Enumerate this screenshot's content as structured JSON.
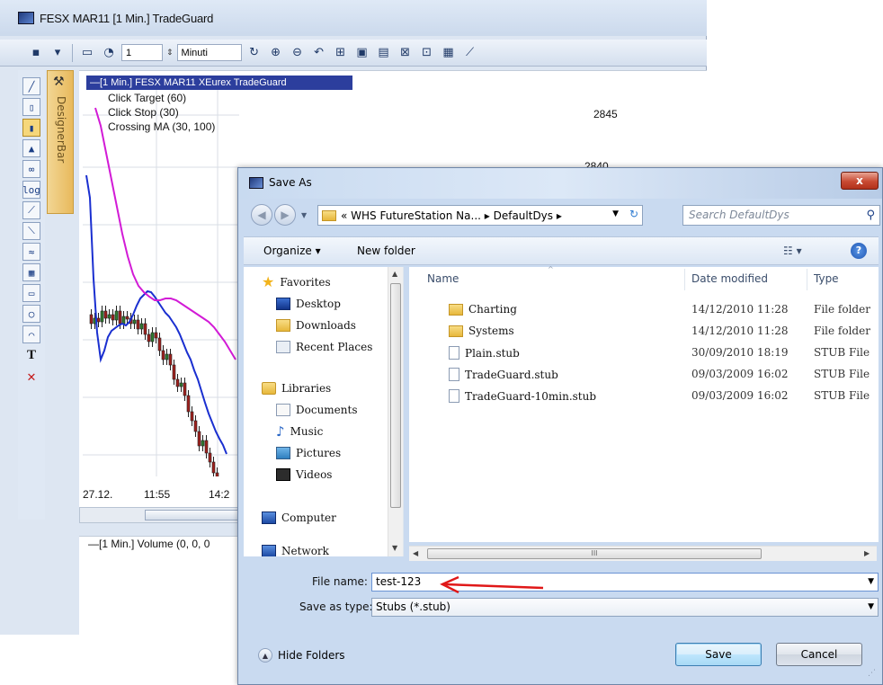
{
  "app": {
    "title": "FESX MAR11 [1 Min.]  TradeGuard",
    "toolbar": {
      "interval_value": "1",
      "interval_unit": "Minuti"
    },
    "designer_bar_label": "DesignerBar",
    "chart": {
      "legend_title": "—[1 Min.] FESX MAR11    XEurex TradeGuard",
      "indicators": [
        "Click Target  (60)",
        "Click Stop  (30)",
        "Crossing MA  (30, 100)"
      ],
      "price_labels": [
        "2845",
        "2840"
      ],
      "time_labels": [
        "27.12.",
        "11:55",
        "14:2"
      ],
      "volume_label": "—[1 Min.] Volume  (0, 0, 0"
    }
  },
  "dialog": {
    "title": "Save As",
    "close_label": "x",
    "breadcrumb": "«  WHS FutureStation Na...  ▸  DefaultDys  ▸",
    "search_placeholder": "Search DefaultDys",
    "organize_label": "Organize ▾",
    "new_folder_label": "New folder",
    "nav": {
      "favorites": "Favorites",
      "desktop": "Desktop",
      "downloads": "Downloads",
      "recent_places": "Recent Places",
      "libraries": "Libraries",
      "documents": "Documents",
      "music": "Music",
      "pictures": "Pictures",
      "videos": "Videos",
      "computer": "Computer",
      "network": "Network"
    },
    "columns": {
      "name": "Name",
      "date_modified": "Date modified",
      "type": "Type"
    },
    "files": [
      {
        "name": "Charting",
        "date": "14/12/2010 11:28",
        "type": "File folder",
        "kind": "folder"
      },
      {
        "name": "Systems",
        "date": "14/12/2010 11:28",
        "type": "File folder",
        "kind": "folder"
      },
      {
        "name": "Plain.stub",
        "date": "30/09/2010 18:19",
        "type": "STUB File",
        "kind": "file"
      },
      {
        "name": "TradeGuard.stub",
        "date": "09/03/2009 16:02",
        "type": "STUB File",
        "kind": "file"
      },
      {
        "name": "TradeGuard-10min.stub",
        "date": "09/03/2009 16:02",
        "type": "STUB File",
        "kind": "file"
      }
    ],
    "file_name_label": "File name:",
    "file_name_value": "test-123",
    "save_as_type_label": "Save as type:",
    "save_as_type_value": "Stubs (*.stub)",
    "hide_folders_label": "Hide Folders",
    "save_label": "Save",
    "cancel_label": "Cancel"
  },
  "colors": {
    "annotation_arrow": "#e01818",
    "chart_ma_magenta": "#d21bd6",
    "chart_ma_blue": "#1a2fd0",
    "legend_bg": "#2c3e9d"
  }
}
